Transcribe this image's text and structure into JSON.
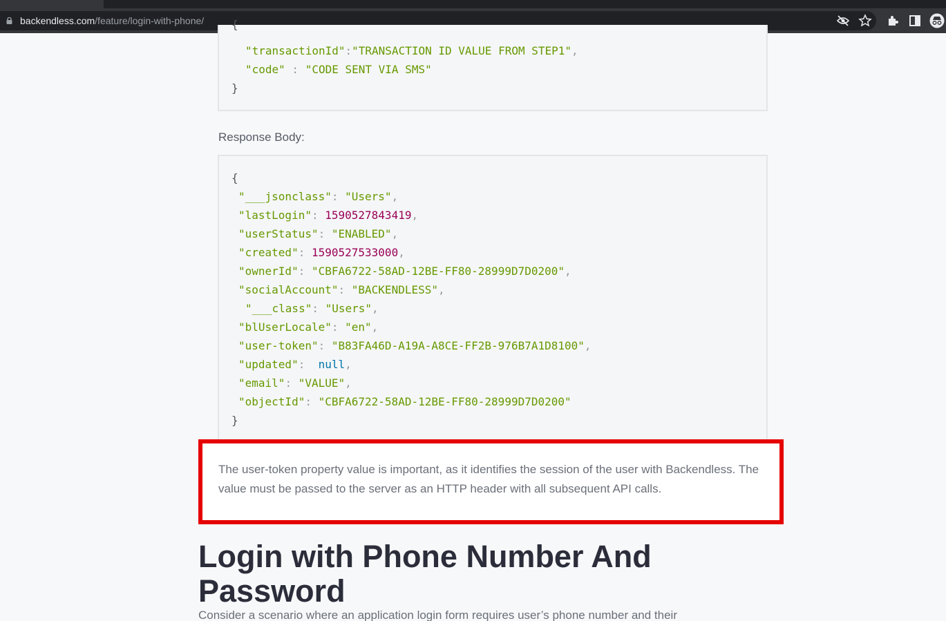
{
  "browser": {
    "url_host": "backendless.com",
    "url_path": "/feature/login-with-phone/",
    "icons": [
      "lock-icon",
      "eye-off-icon",
      "star-icon",
      "extensions-icon",
      "side-panel-icon",
      "incognito-icon"
    ]
  },
  "request_body_tail": {
    "open_brace": "{",
    "lines": [
      {
        "key": "\"transactionId\"",
        "sep": ":",
        "value": "\"TRANSACTION ID VALUE FROM STEP1\"",
        "end": ","
      },
      {
        "key": "\"code\"",
        "sep": " : ",
        "value": "\"CODE SENT VIA SMS\"",
        "end": ""
      }
    ],
    "close_brace": "}"
  },
  "response_label": "Response Body:",
  "response_body": {
    "open_brace": "{",
    "close_brace": "}",
    "lines": [
      {
        "key": "\"___jsonclass\"",
        "value": "\"Users\"",
        "type": "string",
        "end": ","
      },
      {
        "key": "\"lastLogin\"",
        "value": "1590527843419",
        "type": "number",
        "end": ","
      },
      {
        "key": "\"userStatus\"",
        "value": "\"ENABLED\"",
        "type": "string",
        "end": ","
      },
      {
        "key": "\"created\"",
        "value": "1590527533000",
        "type": "number",
        "end": ","
      },
      {
        "key": "\"ownerId\"",
        "value": "\"CBFA6722-58AD-12BE-FF80-28999D7D0200\"",
        "type": "string",
        "end": ","
      },
      {
        "key": "\"socialAccount\"",
        "value": "\"BACKENDLESS\"",
        "type": "string",
        "end": ","
      },
      {
        "key": "\"___class\"",
        "value": "\"Users\"",
        "type": "string",
        "end": ","
      },
      {
        "key": "\"blUserLocale\"",
        "value": "\"en\"",
        "type": "string",
        "end": ","
      },
      {
        "key": "\"user-token\"",
        "value": "\"B83FA46D-A19A-A8CE-FF2B-976B7A1D8100\"",
        "type": "string",
        "end": ","
      },
      {
        "key": "\"updated\"",
        "value": "null",
        "type": "null",
        "end": ","
      },
      {
        "key": "\"email\"",
        "value": "\"VALUE\"",
        "type": "string",
        "end": ","
      },
      {
        "key": "\"objectId\"",
        "value": "\"CBFA6722-58AD-12BE-FF80-28999D7D0200\"",
        "type": "string",
        "end": ""
      }
    ]
  },
  "highlight_note": "The user-token property value is important, as it identifies the session of the user with Backendless. The value must be passed to the server as an HTTP header with all subsequent API calls.",
  "section": {
    "heading": "Login with Phone Number And Password",
    "intro": "Consider a scenario where an application login form requires user’s phone number and their"
  },
  "colors": {
    "highlight_border": "#e60000",
    "code_key": "#669900",
    "code_number": "#990055",
    "code_null": "#0077aa",
    "heading": "#2b2d3a"
  }
}
